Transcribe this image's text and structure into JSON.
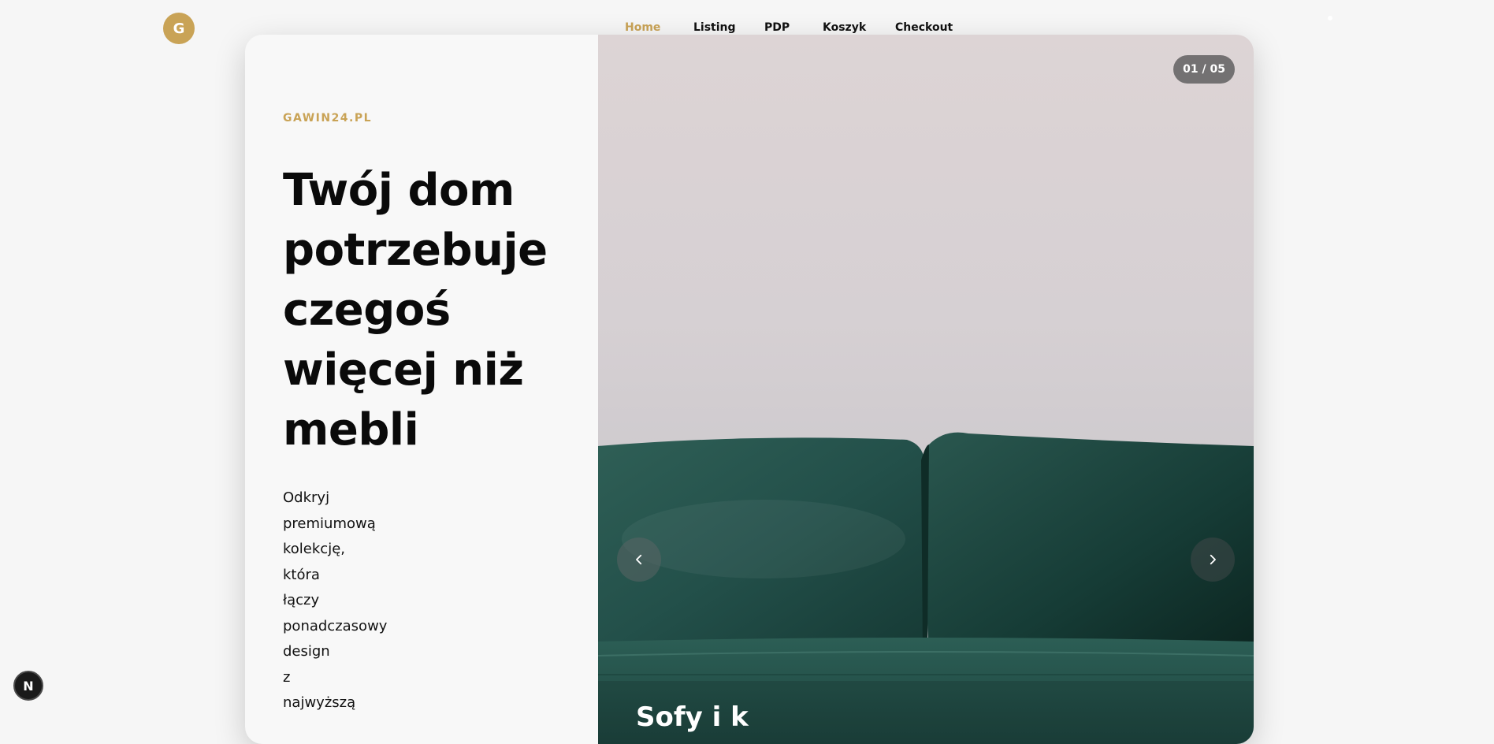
{
  "header": {
    "logo_letter": "G",
    "nav": [
      {
        "label": "Home",
        "active": true
      },
      {
        "label": "Listing",
        "active": false
      },
      {
        "label": "PDP",
        "active": false
      },
      {
        "label": "Koszyk",
        "active": false
      },
      {
        "label": "Checkout",
        "active": false
      }
    ]
  },
  "hero": {
    "brand": "GAWIN24.PL",
    "headline": "Twój dom potrzebuje czegoś więcej niż mebli",
    "description_lines": [
      "Odkryj",
      "premiumową",
      "kolekcję,",
      "która",
      "łączy",
      "ponadczasowy",
      "design",
      "z",
      "najwyższą"
    ]
  },
  "slider": {
    "counter": "01 / 05",
    "slide_title": "Sofy i k",
    "prev_icon": "chevron-left-icon",
    "next_icon": "chevron-right-icon"
  },
  "dev_badge": {
    "letter": "N"
  },
  "colors": {
    "accent": "#c9a356",
    "sofa": "#1f4a43"
  }
}
